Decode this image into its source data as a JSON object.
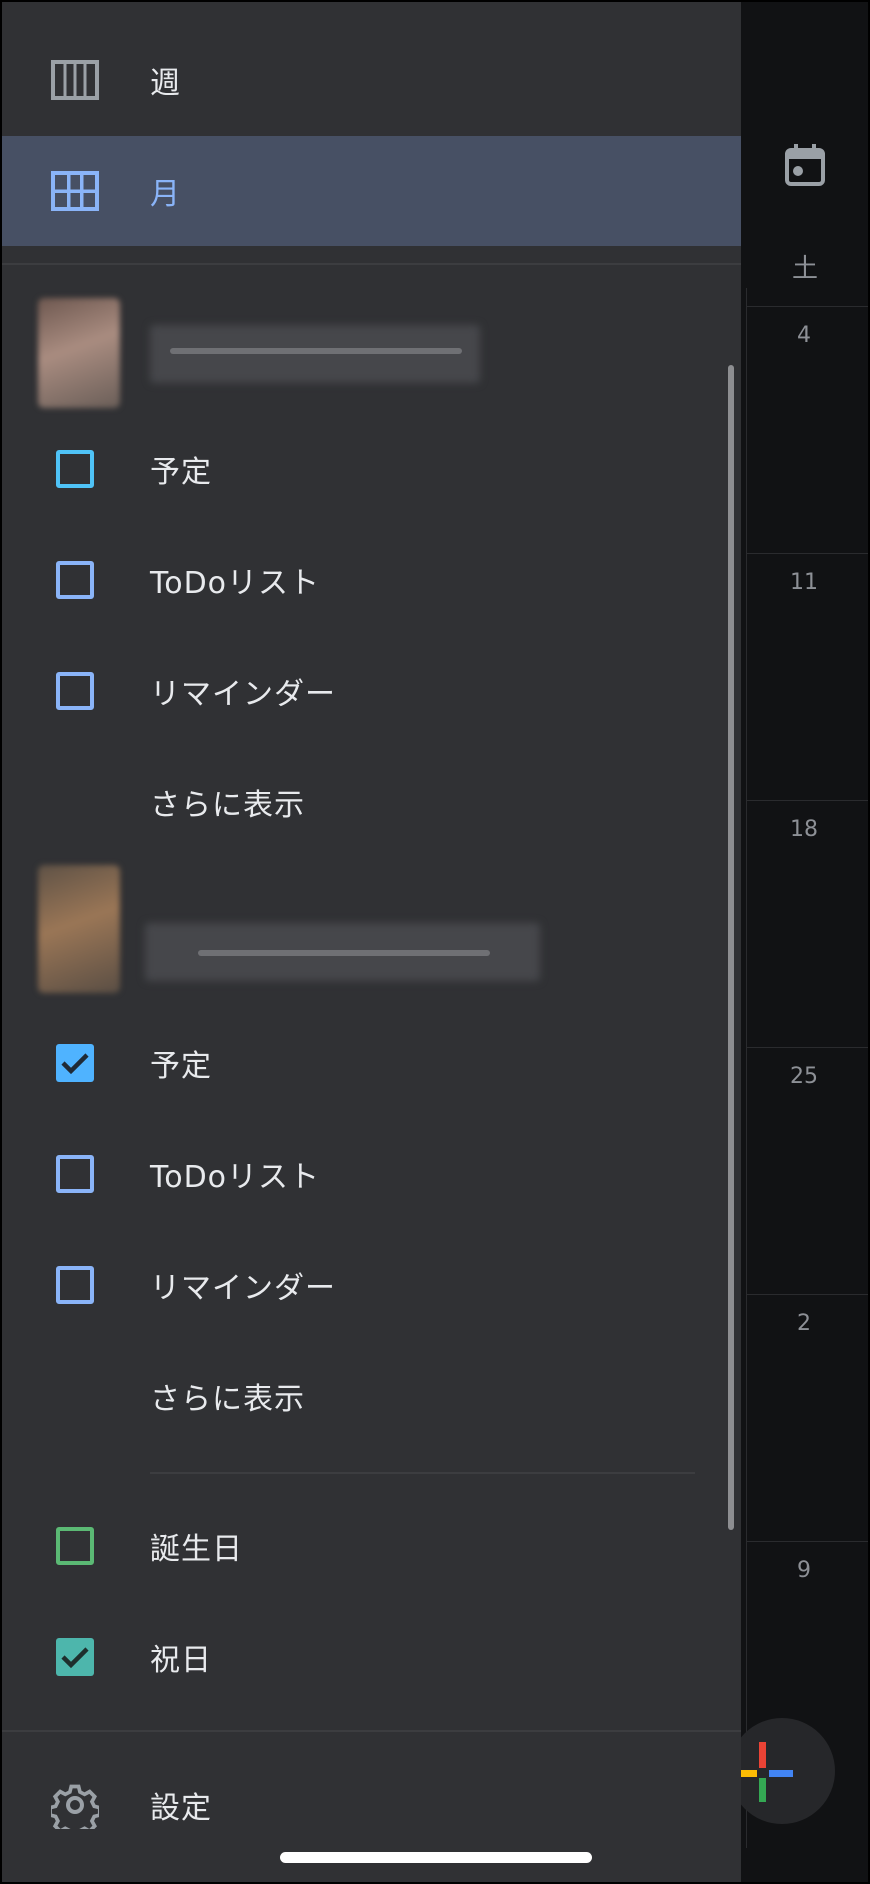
{
  "background_calendar": {
    "weekday_label": "土",
    "dates": [
      "4",
      "11",
      "18",
      "25",
      "2",
      "9"
    ]
  },
  "drawer": {
    "views": [
      {
        "label": "週",
        "icon": "week-view-icon",
        "selected": false
      },
      {
        "label": "月",
        "icon": "month-view-icon",
        "selected": true
      }
    ],
    "accounts": [
      {
        "avatar": "blurred-avatar",
        "name": "",
        "calendars": [
          {
            "label": "予定",
            "checked": false,
            "color": "#4fc3f7"
          },
          {
            "label": "ToDoリスト",
            "checked": false,
            "color": "#8ab4f8"
          },
          {
            "label": "リマインダー",
            "checked": false,
            "color": "#8ab4f8"
          }
        ],
        "more_label": "さらに表示"
      },
      {
        "avatar": "blurred-avatar",
        "name": "",
        "calendars": [
          {
            "label": "予定",
            "checked": true,
            "color": "#4fb3ff"
          },
          {
            "label": "ToDoリスト",
            "checked": false,
            "color": "#8ab4f8"
          },
          {
            "label": "リマインダー",
            "checked": false,
            "color": "#8ab4f8"
          }
        ],
        "more_label": "さらに表示"
      }
    ],
    "other_calendars": [
      {
        "label": "誕生日",
        "checked": false,
        "color": "#5bb974"
      },
      {
        "label": "祝日",
        "checked": true,
        "color": "#4db6ac"
      }
    ],
    "settings_label": "設定"
  },
  "colors": {
    "drawer_bg": "#303134",
    "selected_bg": "#475064",
    "accent": "#8ab4f8",
    "text": "#e8eaed"
  }
}
